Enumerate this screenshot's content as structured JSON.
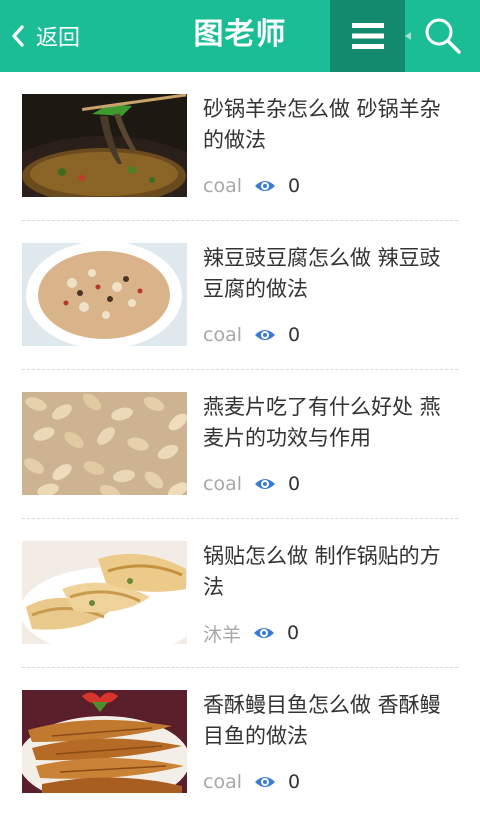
{
  "header": {
    "back_label": "返回",
    "title": "图老师",
    "icons": {
      "back": "chevron-left-icon",
      "menu": "hamburger-menu-icon",
      "search": "search-icon"
    }
  },
  "colors": {
    "brand": "#1bbd97",
    "brand_dark": "#138a6d",
    "eye_icon": "#3a7bd5",
    "author": "#a8a8a8"
  },
  "articles": [
    {
      "title": "砂锅羊杂怎么做 砂锅羊杂的做法",
      "author": "coal",
      "views": "0",
      "image": "mutton-offal-clay-pot"
    },
    {
      "title": "辣豆豉豆腐怎么做 辣豆豉豆腐的做法",
      "author": "coal",
      "views": "0",
      "image": "spicy-black-bean-tofu"
    },
    {
      "title": "燕麦片吃了有什么好处 燕麦片的功效与作用",
      "author": "coal",
      "views": "0",
      "image": "oat-flakes"
    },
    {
      "title": "锅贴怎么做 制作锅贴的方法",
      "author": "沐羊",
      "views": "0",
      "image": "pan-fried-dumplings"
    },
    {
      "title": "香酥鳗目鱼怎么做 香酥鳗目鱼的做法",
      "author": "coal",
      "views": "0",
      "image": "crispy-fried-fish"
    }
  ]
}
